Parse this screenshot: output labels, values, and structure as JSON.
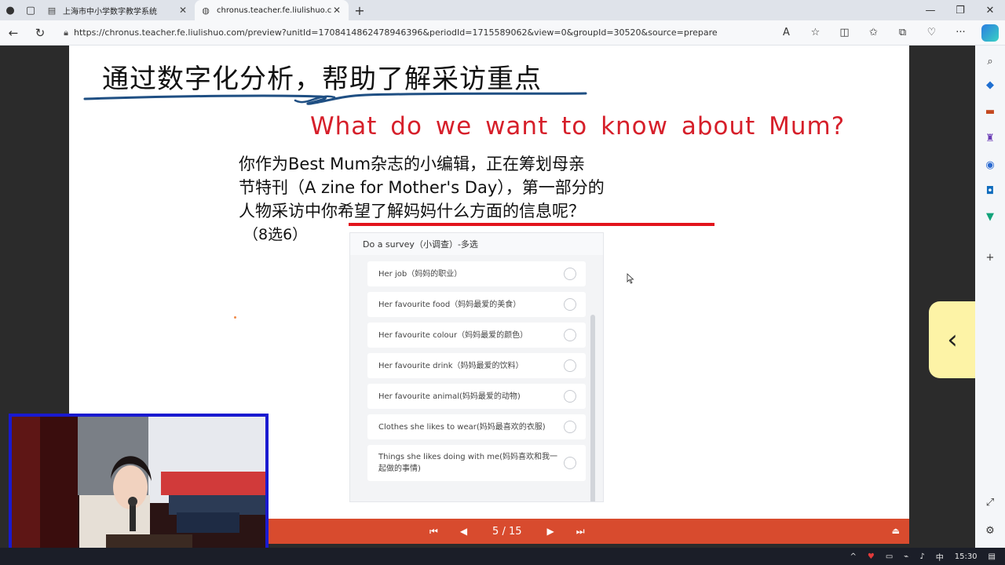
{
  "browser": {
    "tabs": [
      {
        "label": "上海市中小学数字教学系统",
        "active": false
      },
      {
        "label": "chronus.teacher.fe.liulishuo.com",
        "active": true
      }
    ],
    "url": "https://chronus.teacher.fe.liulishuo.com/preview?unitId=1708414862478946396&periodId=1715589062&view=0&groupId=30520&source=prepare"
  },
  "slide": {
    "title": "通过数字化分析，帮助了解采访重点",
    "subtitle": "What do we want to know about Mum?",
    "body_lines": [
      "你作为Best Mum杂志的小编辑，正在筹划母亲",
      "节特刊（A zine for Mother's Day），第一部分的",
      "人物采访中你希望了解妈妈什么方面的信息呢？"
    ],
    "choice_note": "（8选6）"
  },
  "survey": {
    "header": "Do a survey（小调查）-多选",
    "items": [
      {
        "label": "Her job（妈妈的职业）"
      },
      {
        "label": "Her favourite food（妈妈最爱的美食）"
      },
      {
        "label": "Her favourite colour（妈妈最爱的颜色）"
      },
      {
        "label": "Her favourite drink（妈妈最爱的饮料）"
      },
      {
        "label": "Her favourite animal(妈妈最爱的动物)"
      },
      {
        "label": "Clothes she likes to wear(妈妈最喜欢的衣服)"
      },
      {
        "label": "Things she likes doing with me(妈妈喜欢和我一起做的事情)"
      }
    ]
  },
  "player": {
    "page": "5 / 15"
  },
  "taskbar": {
    "time": "15:30"
  },
  "colors": {
    "accent_red": "#d61f2a",
    "toolbar_orange": "#d84b2e",
    "side_toggle_yellow": "#fdf3a6"
  },
  "icons": {
    "first": "first-page-icon",
    "prev": "prev-page-icon",
    "next": "next-page-icon",
    "last": "last-page-icon"
  }
}
